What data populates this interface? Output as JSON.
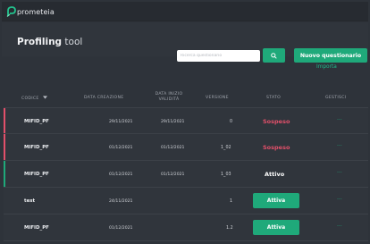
{
  "app": {
    "brand": "prometeia",
    "title_bold": "Profiling",
    "title_light": "tool"
  },
  "toolbar": {
    "search_placeholder": "Ricerca questionario",
    "new_button_label": "Nuovo questionario",
    "import_label": "Importa"
  },
  "table": {
    "headers": {
      "code": "CODICE",
      "created": "DATA CREAZIONE",
      "valid_start_line1": "DATA INIZIO",
      "valid_start_line2": "VALIDITÀ",
      "version": "VERSIONE",
      "state": "STATO",
      "manage": "GESTISCI"
    },
    "rows": [
      {
        "code": "MIFID_PF",
        "created": "29/11/2021",
        "valid_start": "29/11/2021",
        "version": "0",
        "state": "Sospeso",
        "manage": "···"
      },
      {
        "code": "MIFID_PF",
        "created": "01/12/2021",
        "valid_start": "01/12/2021",
        "version": "1_02",
        "state": "Sospeso",
        "manage": "···"
      },
      {
        "code": "MIFID_PF",
        "created": "01/12/2021",
        "valid_start": "01/12/2021",
        "version": "1_03",
        "state": "Attivo",
        "manage": "···"
      },
      {
        "code": "test",
        "created": "24/11/2021",
        "valid_start": "",
        "version": "1",
        "state": "Attiva",
        "manage": "···"
      },
      {
        "code": "MIFID_PF",
        "created": "01/12/2021",
        "valid_start": "",
        "version": "1.2",
        "state": "Attiva",
        "manage": "···"
      }
    ]
  },
  "colors": {
    "accent": "#1fa97a",
    "suspended": "#e2506a",
    "active_bar": "#1fa97a",
    "background": "#2e333a"
  },
  "icons": {
    "search": "search-icon",
    "sort": "sort-down-icon",
    "logo": "prometeia-logo-icon"
  }
}
